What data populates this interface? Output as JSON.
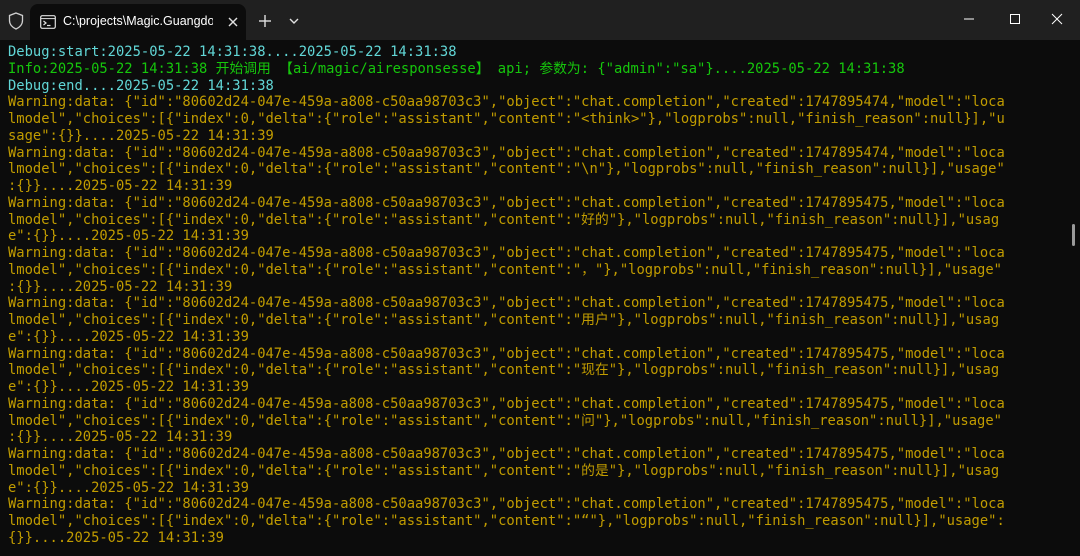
{
  "window": {
    "tab_title": "C:\\projects\\Magic.Guangdong"
  },
  "colors": {
    "debug": "#61d6d6",
    "info": "#16c60c",
    "warning": "#c19c00",
    "background": "#0c0c0c",
    "titlebar": "#202020"
  },
  "icons": {
    "shield": "shield-icon",
    "terminal": "terminal-icon",
    "close_tab": "close-icon",
    "new_tab": "plus-icon",
    "dropdown": "chevron-down-icon",
    "minimize": "minimize-icon",
    "maximize": "maximize-icon",
    "close_window": "close-icon"
  },
  "terminal": {
    "lines": [
      {
        "level": "debug",
        "text": "Debug:start:2025-05-22 14:31:38....2025-05-22 14:31:38"
      },
      {
        "level": "info",
        "text": "Info:2025-05-22 14:31:38 开始调用 【ai/magic/airesponsesse】 api; 参数为: {\"admin\":\"sa\"}....2025-05-22 14:31:38"
      },
      {
        "level": "debug",
        "text": "Debug:end....2025-05-22 14:31:38"
      },
      {
        "level": "warning",
        "text": "Warning:data: {\"id\":\"80602d24-047e-459a-a808-c50aa98703c3\",\"object\":\"chat.completion\",\"created\":1747895474,\"model\":\"loca"
      },
      {
        "level": "warning",
        "text": "lmodel\",\"choices\":[{\"index\":0,\"delta\":{\"role\":\"assistant\",\"content\":\"<think>\"},\"logprobs\":null,\"finish_reason\":null}],\"u"
      },
      {
        "level": "warning",
        "text": "sage\":{}}....2025-05-22 14:31:39"
      },
      {
        "level": "warning",
        "text": "Warning:data: {\"id\":\"80602d24-047e-459a-a808-c50aa98703c3\",\"object\":\"chat.completion\",\"created\":1747895474,\"model\":\"loca"
      },
      {
        "level": "warning",
        "text": "lmodel\",\"choices\":[{\"index\":0,\"delta\":{\"role\":\"assistant\",\"content\":\"\\n\"},\"logprobs\":null,\"finish_reason\":null}],\"usage\""
      },
      {
        "level": "warning",
        "text": ":{}}....2025-05-22 14:31:39"
      },
      {
        "level": "warning",
        "text": "Warning:data: {\"id\":\"80602d24-047e-459a-a808-c50aa98703c3\",\"object\":\"chat.completion\",\"created\":1747895475,\"model\":\"loca"
      },
      {
        "level": "warning",
        "text": "lmodel\",\"choices\":[{\"index\":0,\"delta\":{\"role\":\"assistant\",\"content\":\"好的\"},\"logprobs\":null,\"finish_reason\":null}],\"usag"
      },
      {
        "level": "warning",
        "text": "e\":{}}....2025-05-22 14:31:39"
      },
      {
        "level": "warning",
        "text": "Warning:data: {\"id\":\"80602d24-047e-459a-a808-c50aa98703c3\",\"object\":\"chat.completion\",\"created\":1747895475,\"model\":\"loca"
      },
      {
        "level": "warning",
        "text": "lmodel\",\"choices\":[{\"index\":0,\"delta\":{\"role\":\"assistant\",\"content\":\"，\"},\"logprobs\":null,\"finish_reason\":null}],\"usage\""
      },
      {
        "level": "warning",
        "text": ":{}}....2025-05-22 14:31:39"
      },
      {
        "level": "warning",
        "text": "Warning:data: {\"id\":\"80602d24-047e-459a-a808-c50aa98703c3\",\"object\":\"chat.completion\",\"created\":1747895475,\"model\":\"loca"
      },
      {
        "level": "warning",
        "text": "lmodel\",\"choices\":[{\"index\":0,\"delta\":{\"role\":\"assistant\",\"content\":\"用户\"},\"logprobs\":null,\"finish_reason\":null}],\"usag"
      },
      {
        "level": "warning",
        "text": "e\":{}}....2025-05-22 14:31:39"
      },
      {
        "level": "warning",
        "text": "Warning:data: {\"id\":\"80602d24-047e-459a-a808-c50aa98703c3\",\"object\":\"chat.completion\",\"created\":1747895475,\"model\":\"loca"
      },
      {
        "level": "warning",
        "text": "lmodel\",\"choices\":[{\"index\":0,\"delta\":{\"role\":\"assistant\",\"content\":\"现在\"},\"logprobs\":null,\"finish_reason\":null}],\"usag"
      },
      {
        "level": "warning",
        "text": "e\":{}}....2025-05-22 14:31:39"
      },
      {
        "level": "warning",
        "text": "Warning:data: {\"id\":\"80602d24-047e-459a-a808-c50aa98703c3\",\"object\":\"chat.completion\",\"created\":1747895475,\"model\":\"loca"
      },
      {
        "level": "warning",
        "text": "lmodel\",\"choices\":[{\"index\":0,\"delta\":{\"role\":\"assistant\",\"content\":\"问\"},\"logprobs\":null,\"finish_reason\":null}],\"usage\""
      },
      {
        "level": "warning",
        "text": ":{}}....2025-05-22 14:31:39"
      },
      {
        "level": "warning",
        "text": "Warning:data: {\"id\":\"80602d24-047e-459a-a808-c50aa98703c3\",\"object\":\"chat.completion\",\"created\":1747895475,\"model\":\"loca"
      },
      {
        "level": "warning",
        "text": "lmodel\",\"choices\":[{\"index\":0,\"delta\":{\"role\":\"assistant\",\"content\":\"的是\"},\"logprobs\":null,\"finish_reason\":null}],\"usag"
      },
      {
        "level": "warning",
        "text": "e\":{}}....2025-05-22 14:31:39"
      },
      {
        "level": "warning",
        "text": "Warning:data: {\"id\":\"80602d24-047e-459a-a808-c50aa98703c3\",\"object\":\"chat.completion\",\"created\":1747895475,\"model\":\"loca"
      },
      {
        "level": "warning",
        "text": "lmodel\",\"choices\":[{\"index\":0,\"delta\":{\"role\":\"assistant\",\"content\":\"“\"},\"logprobs\":null,\"finish_reason\":null}],\"usage\":"
      },
      {
        "level": "warning",
        "text": "{}}....2025-05-22 14:31:39"
      }
    ]
  }
}
